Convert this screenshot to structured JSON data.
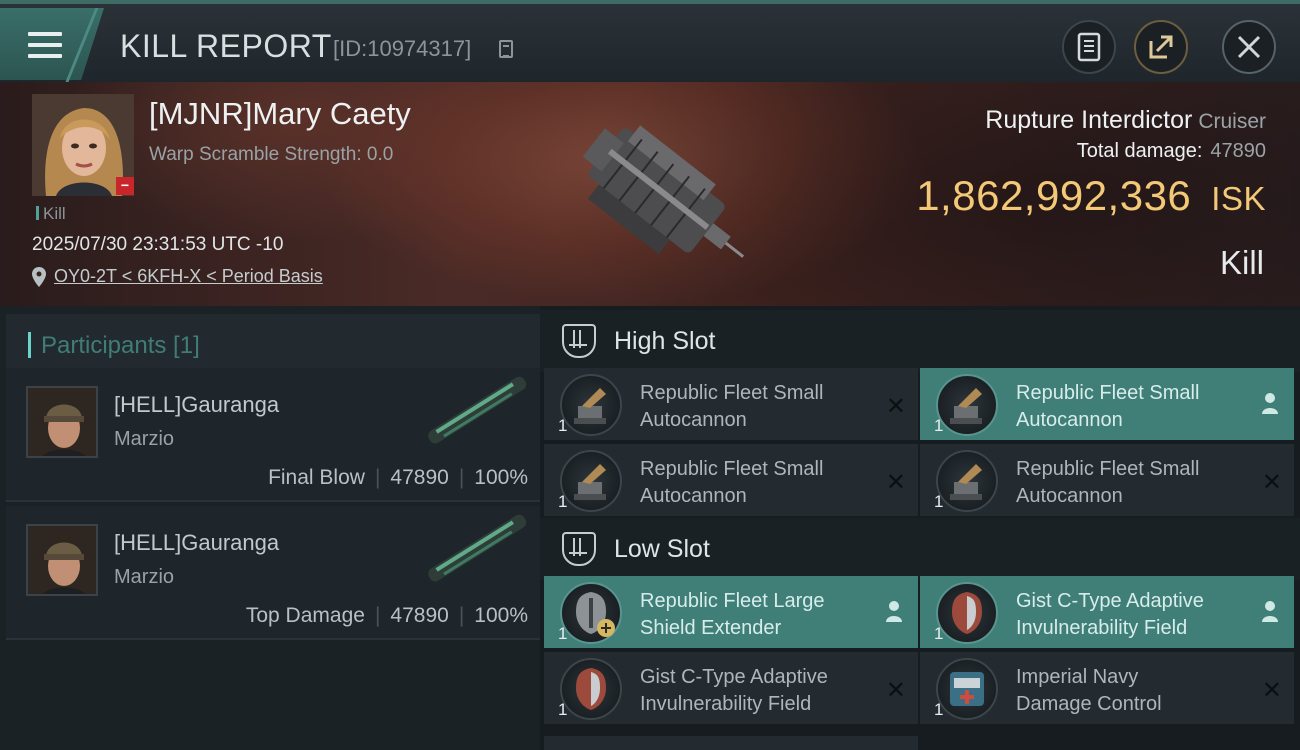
{
  "header": {
    "title": "KILL REPORT",
    "report_id": "[ID:10974317]",
    "menu_icon": "hamburger-menu-icon",
    "buttons": {
      "notes": "notes-icon",
      "share": "share-icon",
      "close": "close-icon"
    }
  },
  "victim": {
    "name": "[MJNR]Mary Caety",
    "warp_scramble": "Warp Scramble Strength: 0.0",
    "kill_tag": "Kill",
    "datetime": "2025/07/30 23:31:53 UTC -10",
    "location": "OY0-2T < 6KFH-X < Period Basis",
    "ship_name": "Rupture Interdictor",
    "ship_class": "Cruiser",
    "total_damage_label": "Total damage:",
    "total_damage": "47890",
    "isk_value": "1,862,992,336",
    "isk_unit": "ISK",
    "result": "Kill"
  },
  "participants": {
    "header": "Participants [1]",
    "rows": [
      {
        "name": "[HELL]Gauranga",
        "ship": "Marzio",
        "role": "Final Blow",
        "damage": "47890",
        "percent": "100%"
      },
      {
        "name": "[HELL]Gauranga",
        "ship": "Marzio",
        "role": "Top Damage",
        "damage": "47890",
        "percent": "100%"
      }
    ]
  },
  "fittings": {
    "high_slot": {
      "title": "High Slot",
      "modules": [
        {
          "line1": "Republic Fleet Small",
          "line2": "Autocannon",
          "qty": "1",
          "state": "destroyed"
        },
        {
          "line1": "Republic Fleet Small",
          "line2": "Autocannon",
          "qty": "1",
          "state": "dropped"
        },
        {
          "line1": "Republic Fleet Small",
          "line2": "Autocannon",
          "qty": "1",
          "state": "destroyed"
        },
        {
          "line1": "Republic Fleet Small",
          "line2": "Autocannon",
          "qty": "1",
          "state": "destroyed"
        }
      ]
    },
    "low_slot": {
      "title": "Low Slot",
      "modules": [
        {
          "line1": "Republic Fleet Large",
          "line2": "Shield Extender",
          "qty": "1",
          "state": "dropped"
        },
        {
          "line1": "Gist C-Type Adaptive",
          "line2": "Invulnerability Field",
          "qty": "1",
          "state": "dropped"
        },
        {
          "line1": "Gist C-Type Adaptive",
          "line2": "Invulnerability Field",
          "qty": "1",
          "state": "destroyed"
        },
        {
          "line1": "Imperial Navy",
          "line2": "Damage Control",
          "qty": "1",
          "state": "destroyed"
        }
      ]
    }
  },
  "colors": {
    "accent": "#3f7f78",
    "isk": "#f3c978",
    "loss_badge": "#c8262a"
  }
}
